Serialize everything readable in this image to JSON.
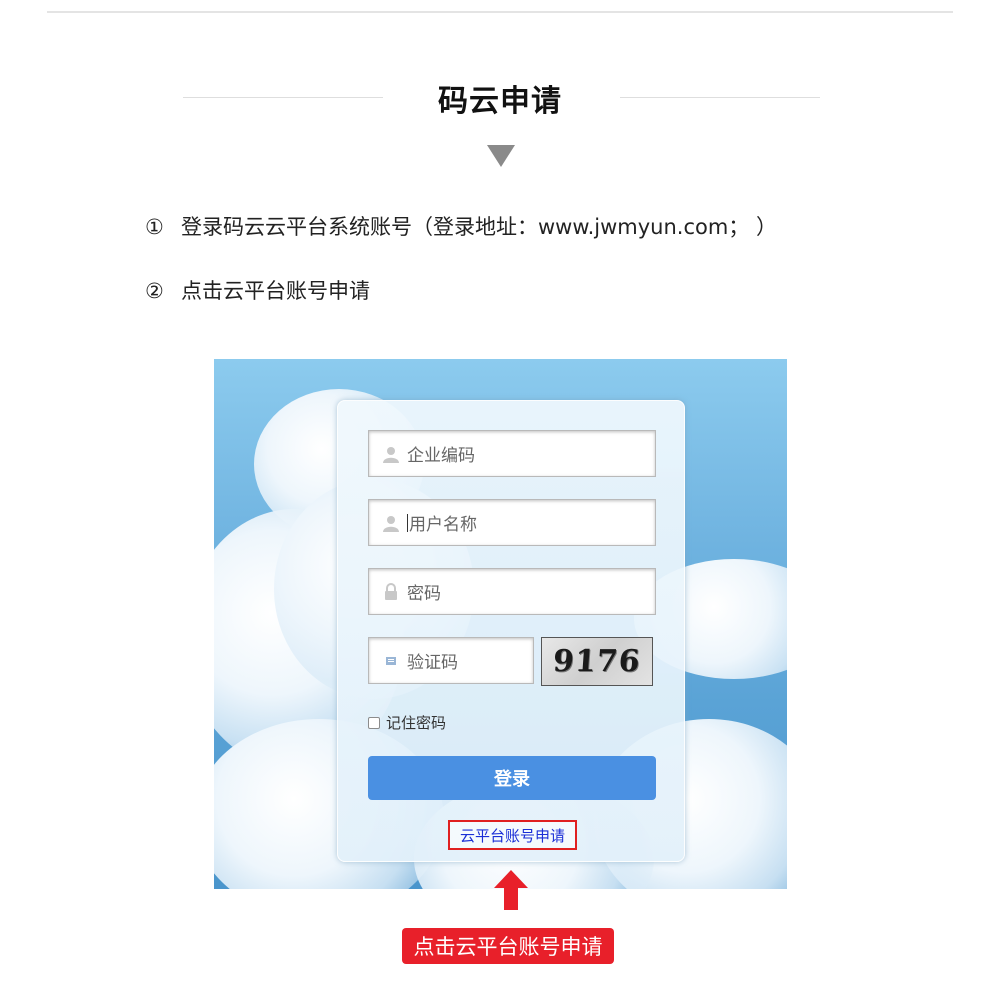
{
  "page": {
    "title": "码云申请",
    "steps": [
      {
        "number": "①",
        "text": "登录码云云平台系统账号（登录地址：www.jwmyun.com；  ）"
      },
      {
        "number": "②",
        "text": "点击云平台账号申请"
      }
    ],
    "callout": "点击云平台账号申请"
  },
  "login": {
    "company_code_placeholder": "企业编码",
    "username_placeholder": "用户名称",
    "password_placeholder": "密码",
    "captcha_placeholder": "验证码",
    "captcha_value": "9176",
    "remember_label": "记住密码",
    "remember_checked": false,
    "login_button": "登录",
    "apply_link": "云平台账号申请"
  },
  "icons": {
    "user": "user-icon",
    "lock": "lock-icon",
    "captcha": "captcha-icon",
    "arrow": "red-up-arrow-icon",
    "triangle": "down-triangle-icon"
  },
  "colors": {
    "login_button": "#4a90e2",
    "highlight": "#e02020",
    "callout_bg": "#e8202a",
    "link": "#1b2fd6"
  }
}
